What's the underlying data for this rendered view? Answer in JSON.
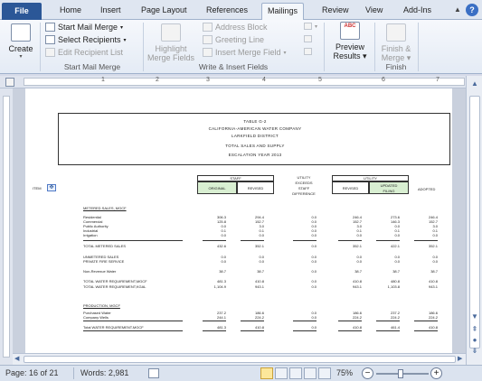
{
  "tabs": {
    "file": "File",
    "items": [
      "Home",
      "Insert",
      "Page Layout",
      "References",
      "Mailings",
      "Review",
      "View",
      "Add-Ins"
    ],
    "active": "Mailings"
  },
  "ribbon": {
    "create": "Create",
    "start_mail_merge": "Start Mail Merge",
    "select_recipients": "Select Recipients",
    "edit_recipient_list": "Edit Recipient List",
    "group_start": "Start Mail Merge",
    "highlight_merge_fields_1": "Highlight",
    "highlight_merge_fields_2": "Merge Fields",
    "address_block": "Address Block",
    "greeting_line": "Greeting Line",
    "insert_merge_field": "Insert Merge Field",
    "group_write": "Write & Insert Fields",
    "preview_1": "Preview",
    "preview_2": "Results",
    "preview_group": "",
    "finish_1": "Finish &",
    "finish_2": "Merge",
    "group_finish": "Finish",
    "abc_label": "ABC"
  },
  "ruler": {
    "numbers": [
      "1",
      "2",
      "3",
      "4",
      "5",
      "6",
      "7"
    ]
  },
  "document": {
    "header": [
      "TABLE G-2",
      "CALIFORNIA-AMERICAN WATER COMPANY",
      "LARKFIELD DISTRICT",
      "TOTAL SALES AND SUPPLY",
      "ESCALATION YEAR 2013"
    ],
    "item_label": "ITEM",
    "col_staff": "STAFF",
    "col_original": "ORIGINAL",
    "col_revised": "REVISED",
    "col_utility_a": "UTILITY",
    "col_utility_b": "EXCEEDS",
    "col_utility_c": "STAFF",
    "col_utility_d": "DIFFERENCE",
    "col_utility": "UTILITY",
    "col_u_revised": "REVISED",
    "col_updated_1": "UPDATED",
    "col_updated_2": "FILING",
    "col_adopted": "ADOPTED",
    "section_metered": "METERED SALES, MGCF",
    "rows": [
      {
        "label": "Residential",
        "v": [
          "306.3",
          "294.4",
          "0.0",
          "246.4",
          "273.6",
          "246.4"
        ]
      },
      {
        "label": "Commercial",
        "v": [
          "125.8",
          "152.7",
          "0.0",
          "152.7",
          "146.3",
          "152.7"
        ]
      },
      {
        "label": "Public Authority",
        "v": [
          "0.0",
          "3.0",
          "0.0",
          "3.0",
          "0.0",
          "3.0"
        ]
      },
      {
        "label": "Industrial",
        "v": [
          "0.1",
          "0.1",
          "0.0",
          "0.1",
          "0.1",
          "0.1"
        ]
      },
      {
        "label": "Irrigation",
        "v": [
          "0.0",
          "0.0",
          "0.0",
          "0.0",
          "0.0",
          "0.0"
        ]
      }
    ],
    "total_metered": {
      "label": "TOTAL METERED SALES",
      "v": [
        "432.6",
        "352.1",
        "0.0",
        "352.1",
        "422.1",
        "352.1"
      ]
    },
    "unmetered_1": {
      "label": "UNMETERED SALES",
      "v": [
        "0.0",
        "0.0",
        "0.0",
        "0.0",
        "0.0",
        "0.0"
      ]
    },
    "unmetered_2": {
      "label": "PRIVATE FIRE SERVICE",
      "v": [
        "0.0",
        "0.0",
        "0.0",
        "0.0",
        "0.0",
        "0.0"
      ]
    },
    "nonrevenue": {
      "label": "Non-Revenue Water",
      "v": [
        "38.7",
        "38.7",
        "0.0",
        "38.7",
        "38.7",
        "38.7"
      ]
    },
    "total_req_a": {
      "label": "TOTAL WATER REQUIREMENT,MGCF",
      "v": [
        "481.3",
        "410.8",
        "0.0",
        "410.8",
        "480.8",
        "410.8"
      ]
    },
    "total_req_b": {
      "label": "TOTAL WATER REQUIREMENT,KGAL",
      "v": [
        "1,104.9",
        "943.1",
        "0.0",
        "943.1",
        "1,103.8",
        "943.1"
      ]
    },
    "section_production": "PRODUCTION, MGCF",
    "purchased": {
      "label": "Purchased Water",
      "v": [
        "237.2",
        "186.6",
        "0.0",
        "186.6",
        "237.2",
        "186.6"
      ]
    },
    "company": {
      "label": "Company Wells",
      "v": [
        "244.1",
        "224.2",
        "0.0",
        "224.2",
        "224.2",
        "224.2"
      ]
    },
    "total_prod": {
      "label": "Total WATER REQUIREMENT,MGCF",
      "v": [
        "481.3",
        "410.8",
        "0.0",
        "410.8",
        "461.4",
        "410.8"
      ]
    }
  },
  "status": {
    "page": "Page: 16 of 21",
    "words": "Words: 2,981",
    "zoom": "75%",
    "zoom_minus": "−",
    "zoom_plus": "+"
  }
}
